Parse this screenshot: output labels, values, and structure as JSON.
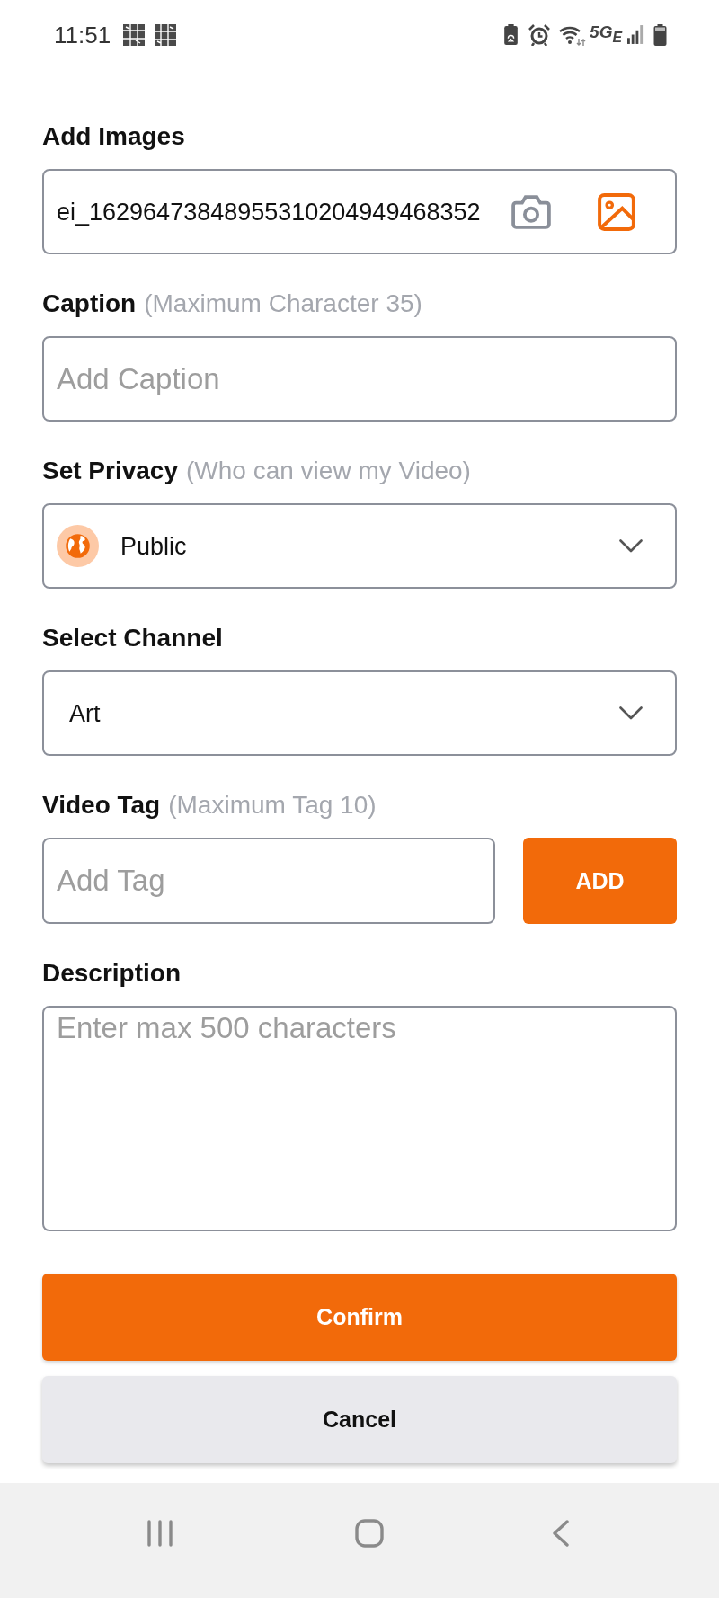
{
  "status_bar": {
    "time": "11:51",
    "network": "5G$_{E}$"
  },
  "form": {
    "sections": [
      {
        "kind": "image_picker",
        "label": "Add Images",
        "value": "ei_16296473848955310204949468352"
      },
      {
        "kind": "text",
        "label": "Caption",
        "hint": "(Maximum Character 35)",
        "placeholder": "Add Caption"
      },
      {
        "kind": "icon_select",
        "label": "Set Privacy",
        "hint": "(Who can view my Video)",
        "value": "Public"
      },
      {
        "kind": "select",
        "label": "Select Channel",
        "value": "Art"
      },
      {
        "kind": "tag",
        "label": "Video Tag",
        "hint": "(Maximum Tag 10)",
        "placeholder": "Add Tag",
        "button": "ADD"
      },
      {
        "kind": "textarea",
        "label": "Description",
        "placeholder": "Enter max 500 characters"
      }
    ]
  },
  "actions": [
    {
      "kind": "primary",
      "label": "Confirm"
    },
    {
      "kind": "secondary",
      "label": "Cancel"
    }
  ]
}
